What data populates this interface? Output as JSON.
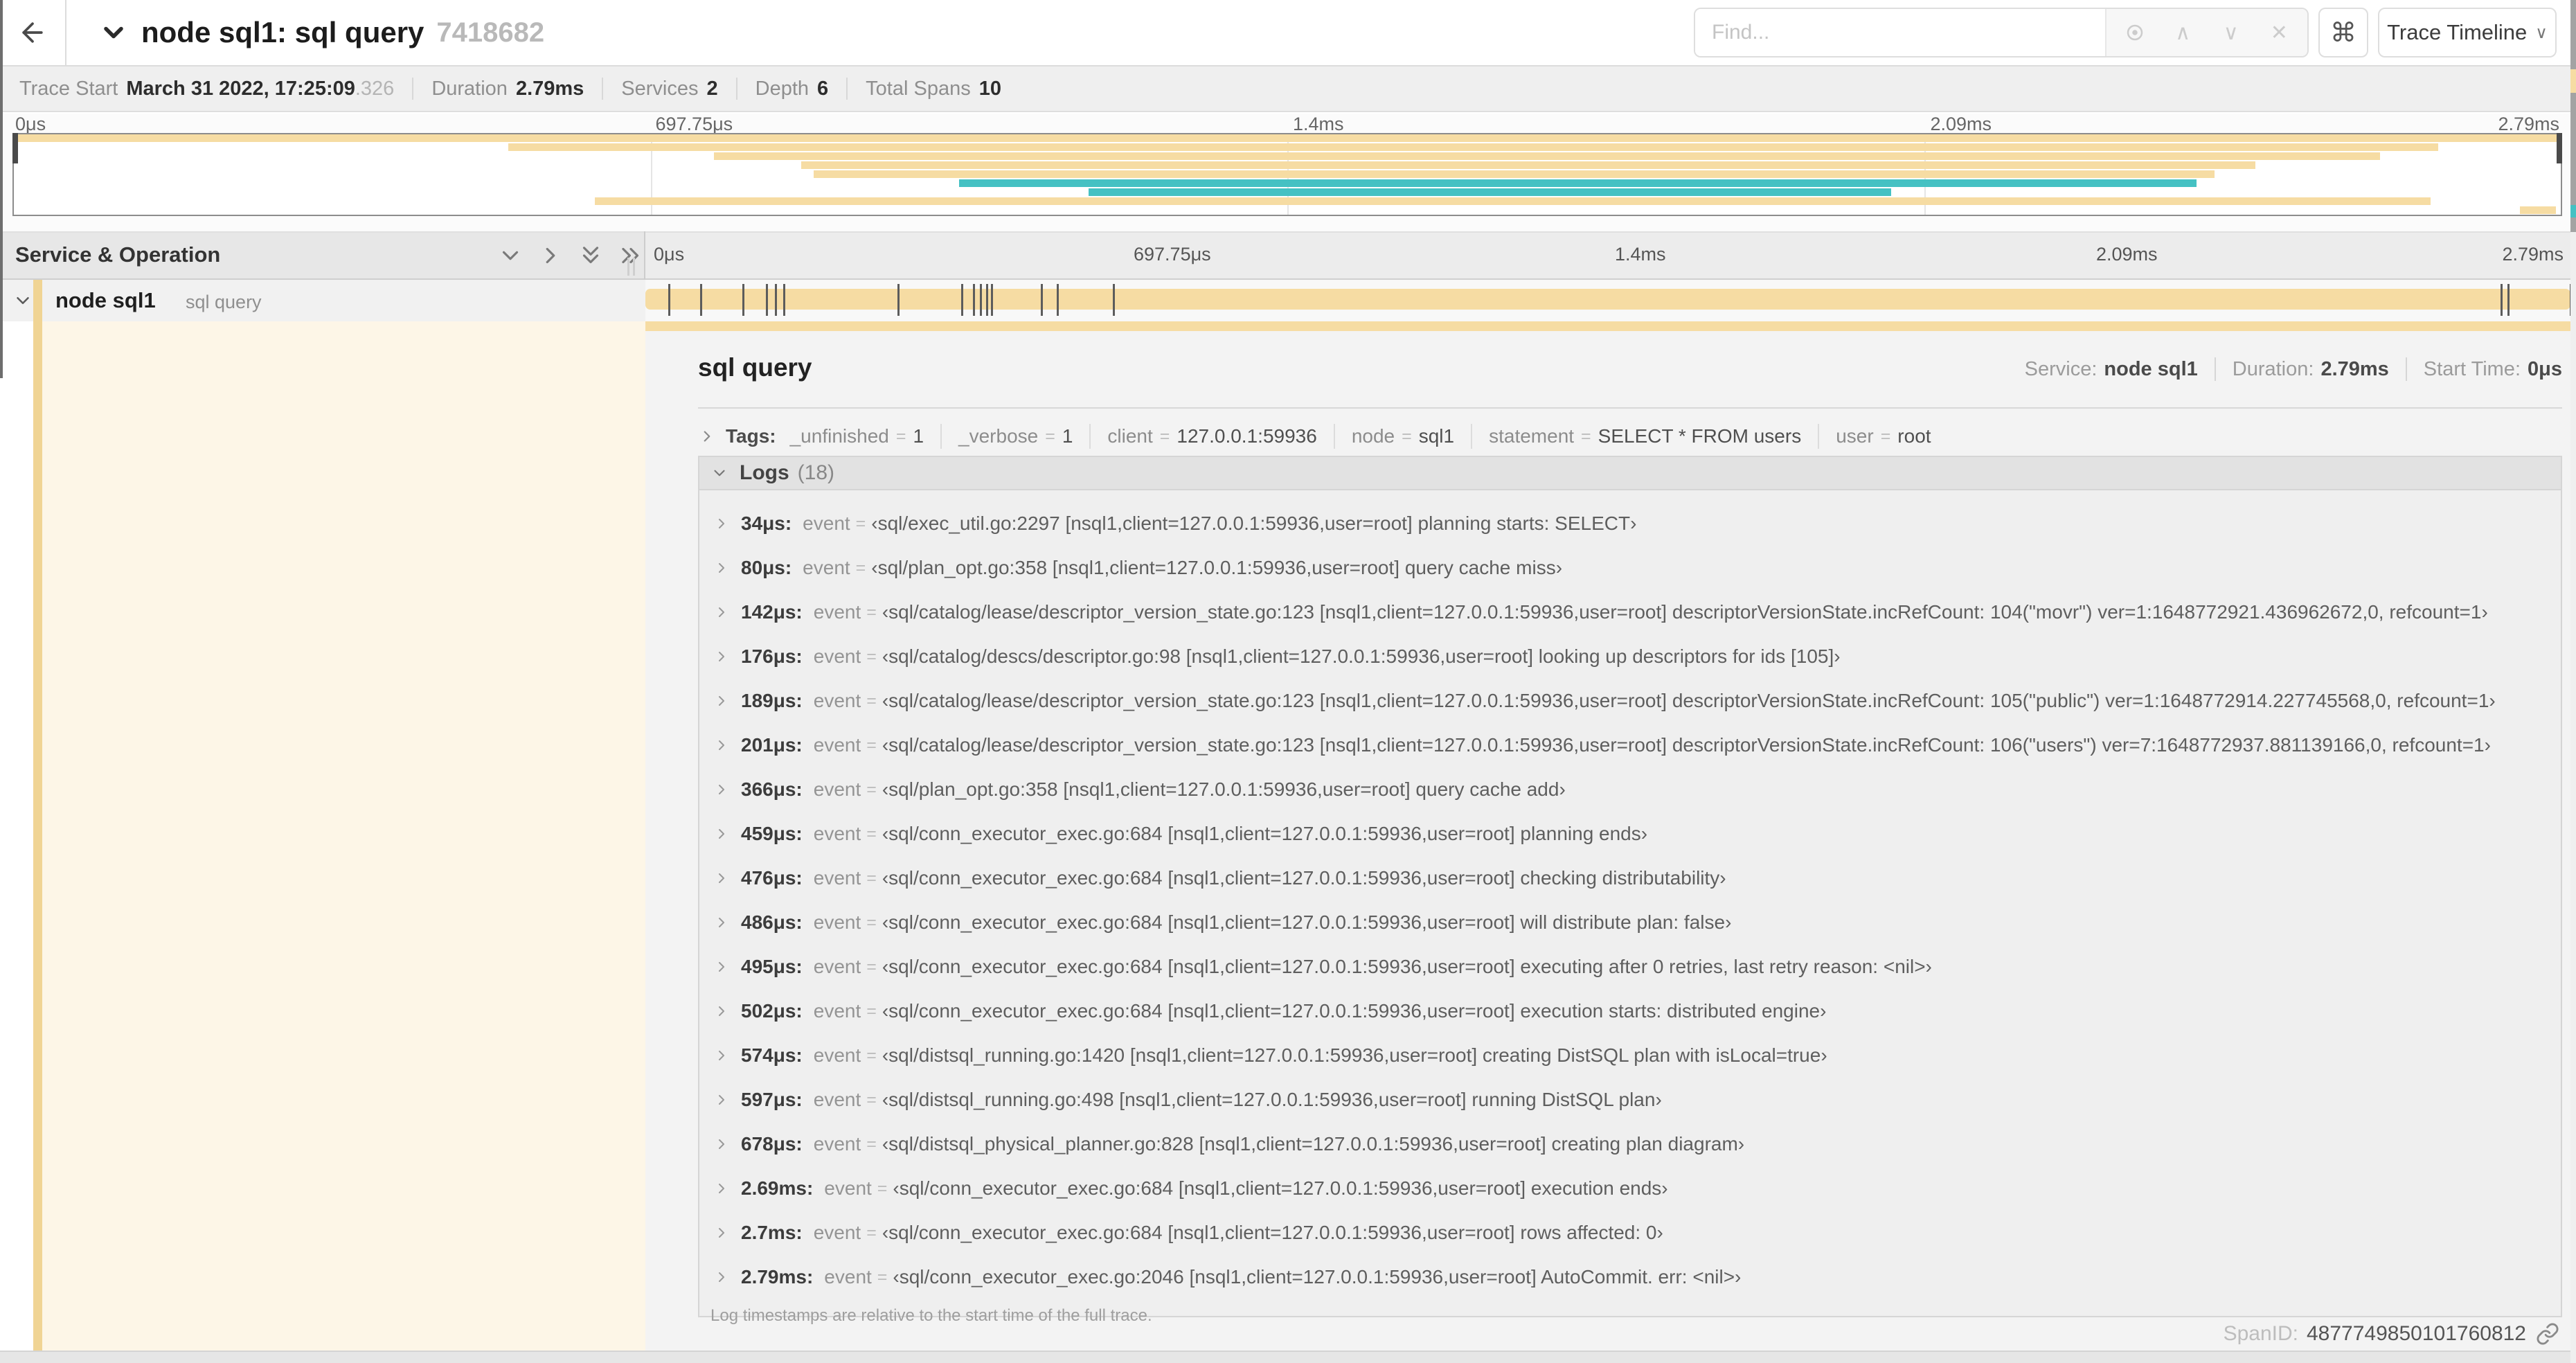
{
  "strings": {
    "eq": "="
  },
  "colors": {
    "span_tan": "#F6DCA3",
    "span_stripe": "#F0D494",
    "teal": "#45C1C3",
    "cream": "#FDF6E7"
  },
  "header": {
    "title": "node sql1: sql query",
    "trace_id": "7418682",
    "find_placeholder": "Find...",
    "shortcut_key": "⌘",
    "view_selector_label": "Trace Timeline",
    "view_caret": "∨",
    "suffix_up": "∧",
    "suffix_down": "∨",
    "suffix_close": "✕"
  },
  "summary": {
    "items": [
      {
        "label": "Trace Start",
        "value": "March 31 2022, 17:25:09",
        "suffix": ".326"
      },
      {
        "label": "Duration",
        "value": "2.79ms",
        "suffix": ""
      },
      {
        "label": "Services",
        "value": "2",
        "suffix": ""
      },
      {
        "label": "Depth",
        "value": "6",
        "suffix": ""
      },
      {
        "label": "Total Spans",
        "value": "10",
        "suffix": ""
      }
    ]
  },
  "timeline": {
    "ticks": [
      "0μs",
      "697.75μs",
      "1.4ms",
      "2.09ms",
      "2.79ms"
    ],
    "duration_us": 2790,
    "minimap_spans": [
      {
        "row": 0,
        "start": 0,
        "end": 100,
        "color": "tan"
      },
      {
        "row": 1,
        "start": 19.4,
        "end": 95.2,
        "color": "tan"
      },
      {
        "row": 2,
        "start": 27.5,
        "end": 92.9,
        "color": "tan"
      },
      {
        "row": 3,
        "start": 30.9,
        "end": 88.0,
        "color": "tan"
      },
      {
        "row": 4,
        "start": 31.4,
        "end": 86.4,
        "color": "tan"
      },
      {
        "row": 5,
        "start": 37.1,
        "end": 85.7,
        "color": "teal"
      },
      {
        "row": 6,
        "start": 42.2,
        "end": 73.7,
        "color": "teal"
      },
      {
        "row": 7,
        "start": 22.8,
        "end": 94.9,
        "color": "tan"
      },
      {
        "row": 8,
        "start": 98.4,
        "end": 99.8,
        "color": "tan"
      }
    ]
  },
  "span_table": {
    "header": "Service & Operation",
    "row": {
      "service": "node sql1",
      "operation": "sql query"
    },
    "log_marker_times_us": [
      34,
      80,
      142,
      176,
      189,
      201,
      366,
      459,
      476,
      486,
      495,
      502,
      574,
      597,
      678,
      2690,
      2700,
      2790
    ]
  },
  "detail": {
    "operation": "sql query",
    "service_label": "Service:",
    "service_value": "node sql1",
    "duration_label": "Duration:",
    "duration_value": "2.79ms",
    "start_label": "Start Time:",
    "start_value": "0μs",
    "tags_label": "Tags:",
    "tags": [
      {
        "key": "_unfinished",
        "value": "1"
      },
      {
        "key": "_verbose",
        "value": "1"
      },
      {
        "key": "client",
        "value": "127.0.0.1:59936"
      },
      {
        "key": "node",
        "value": "sql1"
      },
      {
        "key": "statement",
        "value": "SELECT * FROM users"
      },
      {
        "key": "user",
        "value": "root"
      }
    ],
    "logs_label": "Logs",
    "logs_count": "(18)",
    "logs": [
      {
        "time": "34μs:",
        "field": "event",
        "value": "‹sql/exec_util.go:2297 [nsql1,client=127.0.0.1:59936,user=root] planning starts: SELECT›"
      },
      {
        "time": "80μs:",
        "field": "event",
        "value": "‹sql/plan_opt.go:358 [nsql1,client=127.0.0.1:59936,user=root] query cache miss›"
      },
      {
        "time": "142μs:",
        "field": "event",
        "value": "‹sql/catalog/lease/descriptor_version_state.go:123 [nsql1,client=127.0.0.1:59936,user=root] descriptorVersionState.incRefCount: 104(\"movr\") ver=1:1648772921.436962672,0, refcount=1›"
      },
      {
        "time": "176μs:",
        "field": "event",
        "value": "‹sql/catalog/descs/descriptor.go:98 [nsql1,client=127.0.0.1:59936,user=root] looking up descriptors for ids [105]›"
      },
      {
        "time": "189μs:",
        "field": "event",
        "value": "‹sql/catalog/lease/descriptor_version_state.go:123 [nsql1,client=127.0.0.1:59936,user=root] descriptorVersionState.incRefCount: 105(\"public\") ver=1:1648772914.227745568,0, refcount=1›"
      },
      {
        "time": "201μs:",
        "field": "event",
        "value": "‹sql/catalog/lease/descriptor_version_state.go:123 [nsql1,client=127.0.0.1:59936,user=root] descriptorVersionState.incRefCount: 106(\"users\") ver=7:1648772937.881139166,0, refcount=1›"
      },
      {
        "time": "366μs:",
        "field": "event",
        "value": "‹sql/plan_opt.go:358 [nsql1,client=127.0.0.1:59936,user=root] query cache add›"
      },
      {
        "time": "459μs:",
        "field": "event",
        "value": "‹sql/conn_executor_exec.go:684 [nsql1,client=127.0.0.1:59936,user=root] planning ends›"
      },
      {
        "time": "476μs:",
        "field": "event",
        "value": "‹sql/conn_executor_exec.go:684 [nsql1,client=127.0.0.1:59936,user=root] checking distributability›"
      },
      {
        "time": "486μs:",
        "field": "event",
        "value": "‹sql/conn_executor_exec.go:684 [nsql1,client=127.0.0.1:59936,user=root] will distribute plan: false›"
      },
      {
        "time": "495μs:",
        "field": "event",
        "value": "‹sql/conn_executor_exec.go:684 [nsql1,client=127.0.0.1:59936,user=root] executing after 0 retries, last retry reason: <nil>›"
      },
      {
        "time": "502μs:",
        "field": "event",
        "value": "‹sql/conn_executor_exec.go:684 [nsql1,client=127.0.0.1:59936,user=root] execution starts: distributed engine›"
      },
      {
        "time": "574μs:",
        "field": "event",
        "value": "‹sql/distsql_running.go:1420 [nsql1,client=127.0.0.1:59936,user=root] creating DistSQL plan with isLocal=true›"
      },
      {
        "time": "597μs:",
        "field": "event",
        "value": "‹sql/distsql_running.go:498 [nsql1,client=127.0.0.1:59936,user=root] running DistSQL plan›"
      },
      {
        "time": "678μs:",
        "field": "event",
        "value": "‹sql/distsql_physical_planner.go:828 [nsql1,client=127.0.0.1:59936,user=root] creating plan diagram›"
      },
      {
        "time": "2.69ms:",
        "field": "event",
        "value": "‹sql/conn_executor_exec.go:684 [nsql1,client=127.0.0.1:59936,user=root] execution ends›"
      },
      {
        "time": "2.7ms:",
        "field": "event",
        "value": "‹sql/conn_executor_exec.go:684 [nsql1,client=127.0.0.1:59936,user=root] rows affected: 0›"
      },
      {
        "time": "2.79ms:",
        "field": "event",
        "value": "‹sql/conn_executor_exec.go:2046 [nsql1,client=127.0.0.1:59936,user=root] AutoCommit. err: <nil>›"
      }
    ],
    "logs_footnote": "Log timestamps are relative to the start time of the full trace.",
    "span_id_label": "SpanID:",
    "span_id": "4877749850101760812"
  }
}
